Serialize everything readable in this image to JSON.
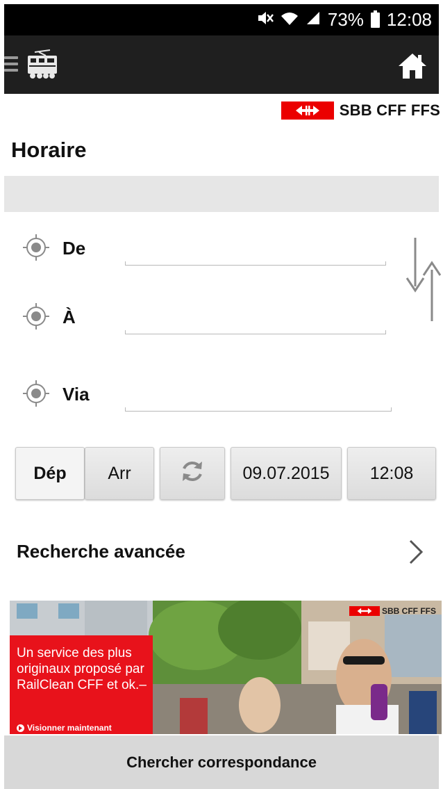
{
  "status_bar": {
    "icons": [
      "mute-icon",
      "wifi-icon",
      "signal-icon",
      "battery-icon"
    ],
    "battery": "73%",
    "time": "12:08"
  },
  "app_bar": {
    "menu_icon": "hamburger-icon",
    "app_icon": "train-icon",
    "home_icon": "home-icon"
  },
  "brand": {
    "logo_text": "SBB CFF FFS",
    "red": "#eb0000"
  },
  "page": {
    "title": "Horaire"
  },
  "form": {
    "from_label": "De",
    "to_label": "À",
    "via_label": "Via",
    "from_value": "",
    "to_value": "",
    "via_value": "",
    "swap_icon": "swap-arrows-icon",
    "location_icon": "locate-icon"
  },
  "options": {
    "departure": "Dép",
    "arrival": "Arr",
    "refresh_icon": "refresh-icon",
    "date": "09.07.2015",
    "time": "12:08",
    "selected": "departure"
  },
  "advanced": {
    "label": "Recherche avancée",
    "chevron_icon": "chevron-right-icon"
  },
  "banner": {
    "text": "Un service des plus originaux proposé par RailClean CFF et ok.–",
    "link": "Visionner maintenant",
    "logo_text": "SBB CFF FFS",
    "red": "#e8121b"
  },
  "search_button": "Chercher correspondance"
}
